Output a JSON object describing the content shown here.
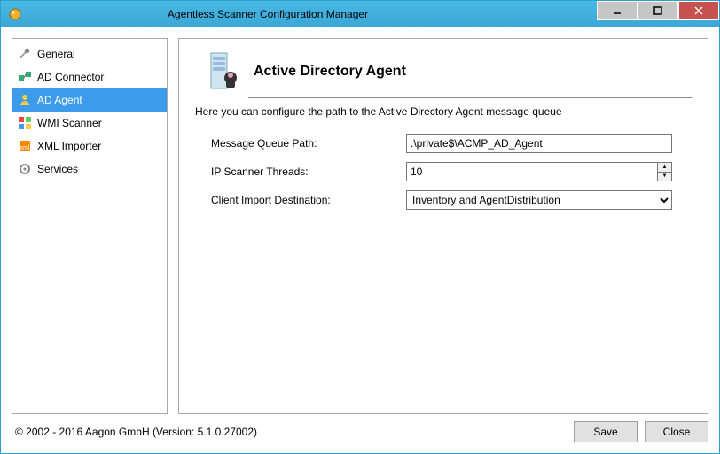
{
  "window": {
    "title": "Agentless Scanner Configuration Manager"
  },
  "sidebar": {
    "items": [
      {
        "label": "General"
      },
      {
        "label": "AD Connector"
      },
      {
        "label": "AD Agent"
      },
      {
        "label": "WMI Scanner"
      },
      {
        "label": "XML Importer"
      },
      {
        "label": "Services"
      }
    ],
    "selectedIndex": 2
  },
  "page": {
    "title": "Active Directory Agent",
    "subtitle": "Here you can configure the path to the Active Directory Agent message queue",
    "fields": {
      "message_queue": {
        "label": "Message Queue Path:",
        "value": ".\\private$\\ACMP_AD_Agent"
      },
      "threads": {
        "label": "IP Scanner Threads:",
        "value": "10"
      },
      "destination": {
        "label": "Client Import Destination:",
        "value": "Inventory and AgentDistribution"
      }
    }
  },
  "footer": {
    "copyright": "© 2002 - 2016 Aagon GmbH (Version: 5.1.0.27002)",
    "save": "Save",
    "close": "Close"
  }
}
